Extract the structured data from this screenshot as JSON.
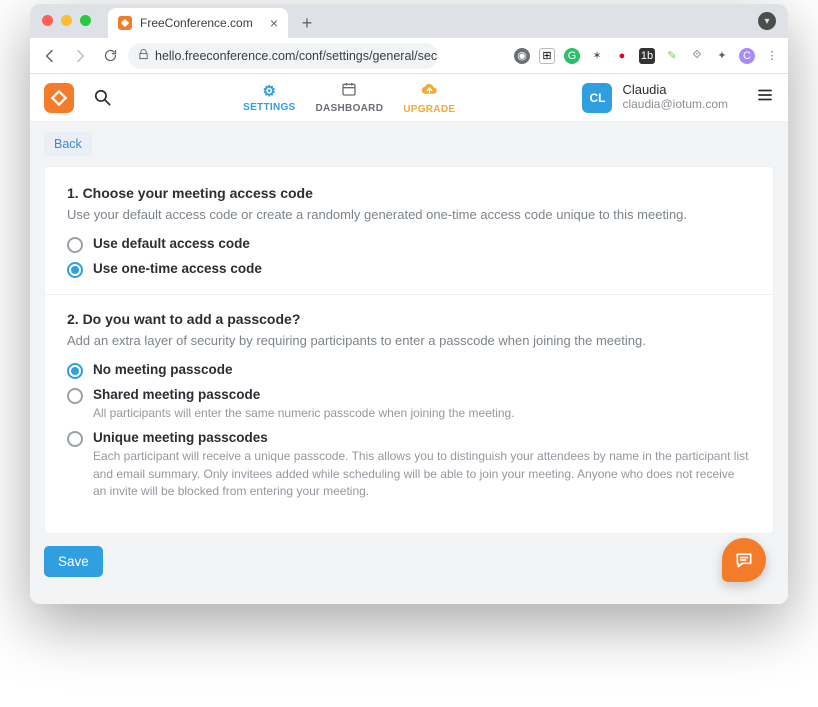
{
  "browser": {
    "tab_title": "FreeConference.com",
    "url": "hello.freeconference.com/conf/settings/general/securit..."
  },
  "nav": {
    "settings": "SETTINGS",
    "dashboard": "DASHBOARD",
    "upgrade": "UPGRADE"
  },
  "user": {
    "initials": "CL",
    "name": "Claudia",
    "email": "claudia@iotum.com"
  },
  "page": {
    "back": "Back",
    "section1": {
      "title": "1. Choose your meeting access code",
      "desc": "Use your default access code or create a randomly generated one-time access code unique to this meeting.",
      "opt_default": "Use default access code",
      "opt_onetime": "Use one-time access code"
    },
    "section2": {
      "title": "2. Do you want to add a passcode?",
      "desc": "Add an extra layer of security by requiring participants to enter a passcode when joining the meeting.",
      "opt_none": "No meeting passcode",
      "opt_shared": "Shared meeting passcode",
      "opt_shared_sub": "All participants will enter the same numeric passcode when joining the meeting.",
      "opt_unique": "Unique meeting passcodes",
      "opt_unique_sub": "Each participant will receive a unique passcode. This allows you to distinguish your attendees by name in the participant list and email summary. Only invitees added while scheduling will be able to join your meeting. Anyone who does not receive an invite will be blocked from entering your meeting."
    },
    "save": "Save"
  }
}
